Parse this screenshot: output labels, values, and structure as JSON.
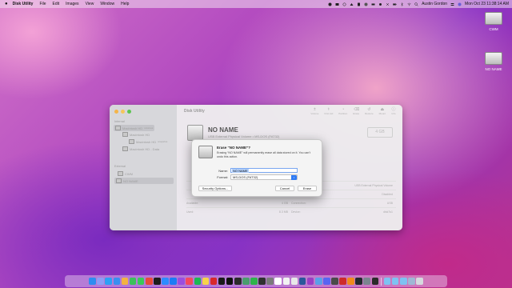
{
  "menubar": {
    "app_name": "Disk Utility",
    "items": [
      "File",
      "Edit",
      "Images",
      "View",
      "Window",
      "Help"
    ],
    "user": "Austin Gordon",
    "clock": "Mon Oct 23  11:38:14 AM"
  },
  "desktop_icons": [
    {
      "label": "CWM"
    },
    {
      "label": "NO NAME"
    }
  ],
  "window": {
    "title": "Disk Utility",
    "sidebar": {
      "internal_header": "Internal",
      "internal_items": [
        {
          "label": "Macintosh HD",
          "tag": "volumes"
        },
        {
          "label": "Macintosh HD"
        },
        {
          "label": "Macintosh HD",
          "tag": "snapshot"
        },
        {
          "label": "Macintosh HD - Data"
        }
      ],
      "external_header": "External",
      "external_items": [
        {
          "label": "CWM"
        },
        {
          "label": "NO NAME"
        }
      ]
    },
    "toolbar": [
      "Volume",
      "First Aid",
      "Partition",
      "Erase",
      "Restore",
      "Mount",
      "Info"
    ],
    "volume": {
      "name": "NO NAME",
      "subtitle": "USB External Physical Volume • MS-DOS (FAT32)",
      "size": "4 GB"
    },
    "info_rows": [
      [
        "",
        "",
        "",
        "USB External Physical Volume"
      ],
      [
        "",
        "",
        "",
        "Disabled"
      ],
      [
        "Available:",
        "4 GB",
        "Connection:",
        "USB"
      ],
      [
        "Used:",
        "8.3 MB",
        "Device:",
        "disk7s1"
      ]
    ]
  },
  "dialog": {
    "title": "Erase “NO NAME”?",
    "message": "Erasing “NO NAME” will permanently erase all data stored on it. You can't undo this action.",
    "name_label": "Name:",
    "name_value": "NO NAME",
    "format_label": "Format:",
    "format_value": "MS-DOS (FAT32)",
    "security_button": "Security Options...",
    "cancel_button": "Cancel",
    "erase_button": "Erase"
  },
  "dock": {
    "apps": [
      {
        "name": "finder",
        "color": "#2f8cf0"
      },
      {
        "name": "launchpad",
        "color": "#8e9cf5"
      },
      {
        "name": "safari",
        "color": "#2da0f5"
      },
      {
        "name": "mail",
        "color": "#3a8ff0"
      },
      {
        "name": "photos",
        "color": "#f3b341"
      },
      {
        "name": "facetime",
        "color": "#3cc15b"
      },
      {
        "name": "messages",
        "color": "#39c85a"
      },
      {
        "name": "chrome",
        "color": "#e9493b"
      },
      {
        "name": "quicktime",
        "color": "#1d1d1d"
      },
      {
        "name": "zoom",
        "color": "#2d8cff"
      },
      {
        "name": "app-store",
        "color": "#1c7cf5"
      },
      {
        "name": "podcasts",
        "color": "#9b4ee0"
      },
      {
        "name": "music",
        "color": "#f5495f"
      },
      {
        "name": "spotify",
        "color": "#1db954"
      },
      {
        "name": "notes",
        "color": "#f7d34a"
      },
      {
        "name": "acrobat",
        "color": "#d8282c"
      },
      {
        "name": "tv",
        "color": "#1a1a1a"
      },
      {
        "name": "capcut",
        "color": "#111111"
      },
      {
        "name": "terminal",
        "color": "#2b2b2b"
      },
      {
        "name": "pixelmator",
        "color": "#4a9d6e"
      },
      {
        "name": "numbers",
        "color": "#2fb34b"
      },
      {
        "name": "activity-monitor",
        "color": "#303030"
      },
      {
        "name": "system-preferences",
        "color": "#7b7b7b"
      },
      {
        "name": "calendar",
        "color": "#ffffff"
      },
      {
        "name": "reminders",
        "color": "#f2f2f2"
      },
      {
        "name": "textedit",
        "color": "#e8e8e8"
      },
      {
        "name": "word",
        "color": "#2b579a"
      },
      {
        "name": "affinity",
        "color": "#9c3dc4"
      },
      {
        "name": "preview",
        "color": "#5aa0e8"
      },
      {
        "name": "discord",
        "color": "#5865f2"
      },
      {
        "name": "calculator",
        "color": "#4a4a4a"
      },
      {
        "name": "acrobat-2",
        "color": "#ce2a2a"
      },
      {
        "name": "vlc",
        "color": "#f08a1c"
      },
      {
        "name": "github",
        "color": "#24292e"
      },
      {
        "name": "disk-utility",
        "color": "#7b8590"
      },
      {
        "name": "obs",
        "color": "#2b2b2b"
      }
    ],
    "stack": [
      {
        "name": "downloads-folder",
        "color": "#7ec2f2"
      },
      {
        "name": "documents-folder",
        "color": "#7ec2f2"
      },
      {
        "name": "applications-folder",
        "color": "#7ec2f2"
      },
      {
        "name": "files-stack",
        "color": "#9fb7d4"
      },
      {
        "name": "trash",
        "color": "#d6d9de"
      }
    ]
  }
}
